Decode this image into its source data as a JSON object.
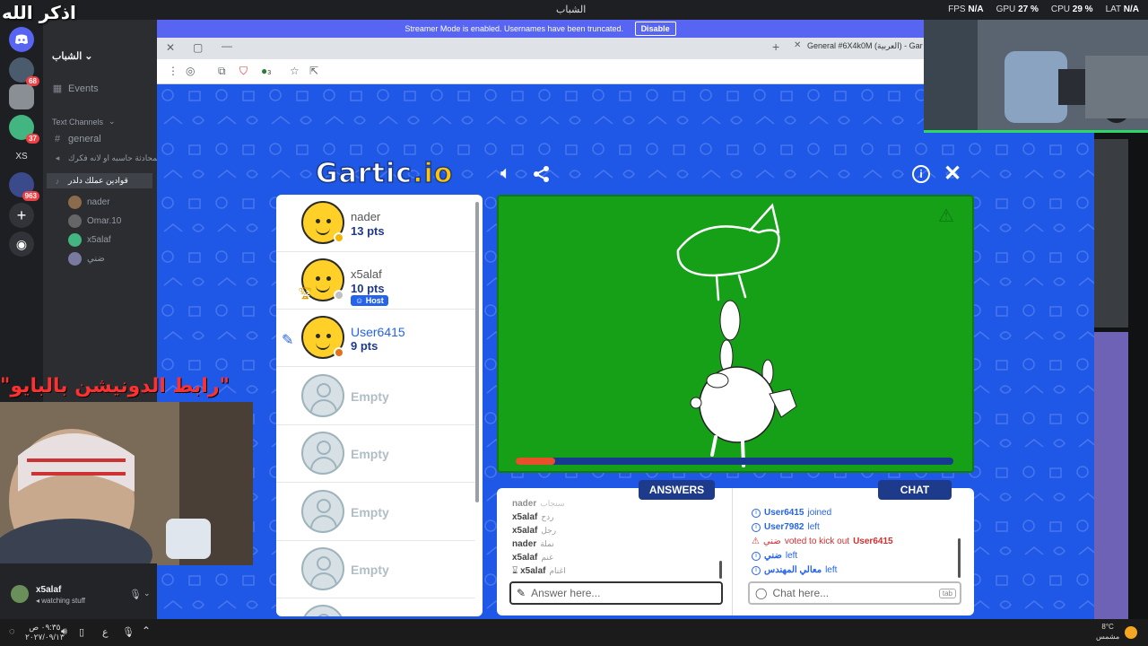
{
  "overlay": {
    "dhikr": "اذكر الله",
    "donation": "\"رابط الدونيشن بالبايو\""
  },
  "topbar": {
    "window_title": "الشباب",
    "fps_label": "FPS",
    "fps_value": "N/A",
    "gpu_label": "GPU",
    "gpu_value": "27 %",
    "cpu_label": "CPU",
    "cpu_value": "29 %",
    "lat_label": "LAT",
    "lat_value": "N/A"
  },
  "discord": {
    "server_name": "الشباب",
    "events": "Events",
    "text_channels_header": "Text Channels",
    "channels": [
      {
        "name": "general",
        "sym": "#"
      },
      {
        "name": "للمحادثة حاسبه او لانه فكرك",
        "sym": "◂"
      },
      {
        "name": "قوادين عملك دلدر",
        "sym": "♪"
      }
    ],
    "voice_users": [
      "nader",
      "Omar.10",
      "x5alaf",
      "ضني"
    ],
    "server_badges": [
      "68",
      "37",
      "963"
    ],
    "server_text": "XS",
    "user_name": "x5alaf",
    "user_status": "watching stuff"
  },
  "browser": {
    "streamer_banner": "Streamer Mode is enabled. Usernames have been truncated.",
    "disable_label": "Disable",
    "tab_title": "General #6X4k0M (العربية) - Gar",
    "extension_badge": "3"
  },
  "game": {
    "logo_main": "Gartic",
    "logo_suffix": ".io",
    "players": [
      {
        "name": "nader",
        "points": "13 pts",
        "dot": "#f5b400",
        "host": false
      },
      {
        "name": "x5alaf",
        "points": "10 pts",
        "dot": "#c0c0c0",
        "host": true,
        "rank": "2"
      },
      {
        "name": "User6415",
        "points": "9 pts",
        "dot": "#e2701d",
        "host": false,
        "drawing": true
      }
    ],
    "host_label": "Host",
    "empty_label": "Empty",
    "empty_count": 4,
    "round_progress": 0.09,
    "answers_tab": "ANSWERS",
    "chat_tab": "CHAT",
    "answers": [
      {
        "user": "nader",
        "word": "سنجاب"
      },
      {
        "user": "x5alaf",
        "word": "ردح"
      },
      {
        "user": "x5alaf",
        "word": "رجل"
      },
      {
        "user": "nader",
        "word": "نملة"
      },
      {
        "user": "x5alaf",
        "word": "غنم"
      },
      {
        "user": "x5alaf",
        "word": "اغنام"
      }
    ],
    "chat": [
      {
        "user": "User6415",
        "text": "joined",
        "type": "info"
      },
      {
        "user": "User7982",
        "text": "left",
        "type": "info"
      },
      {
        "user": "ضني",
        "text": "voted to kick out",
        "target": "User6415",
        "type": "warn"
      },
      {
        "user": "ضني",
        "text": "left",
        "type": "info"
      },
      {
        "user": "معالي المهندس",
        "text": "left",
        "type": "info"
      }
    ],
    "answer_placeholder": "Answer here...",
    "chat_placeholder": "Chat here...",
    "tab_key": "tab"
  },
  "taskbar": {
    "time": "٠٩:٣٥ ص",
    "date": "٢٠٢٧/٠٩/١٣",
    "lang": "ع",
    "weather": "8°C",
    "weather_desc": "مشمس"
  }
}
